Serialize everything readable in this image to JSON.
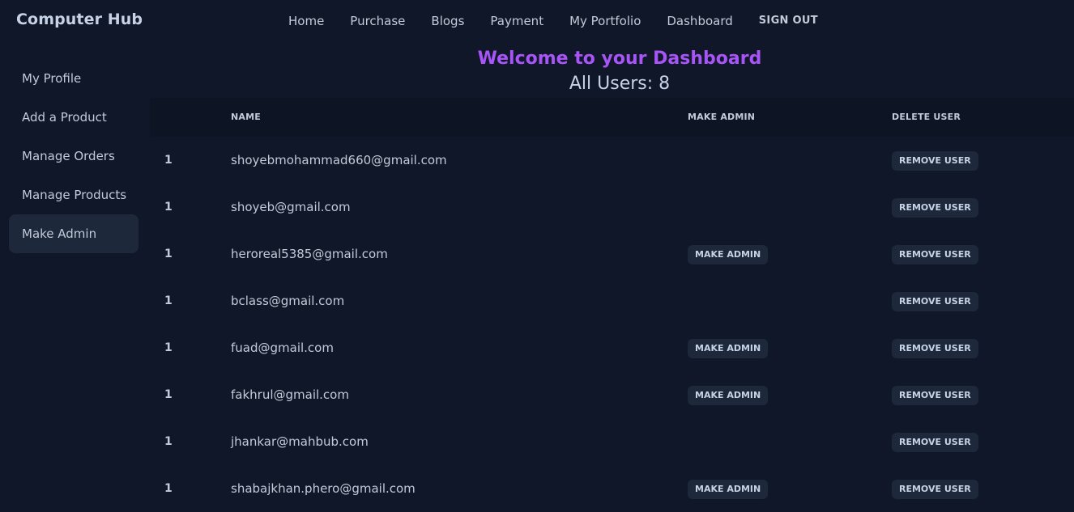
{
  "app": {
    "brand": "Computer Hub"
  },
  "nav": {
    "links": [
      "Home",
      "Purchase",
      "Blogs",
      "Payment",
      "My Portfolio",
      "Dashboard"
    ],
    "signout": "SIGN OUT"
  },
  "sidebar": {
    "items": [
      "My Profile",
      "Add a Product",
      "Manage Orders",
      "Manage Products",
      "Make Admin"
    ],
    "active": "Make Admin"
  },
  "main": {
    "welcome": "Welcome to your Dashboard",
    "user_count_label": "All Users: 8"
  },
  "table": {
    "headers": {
      "index": "",
      "name": "Name",
      "make_admin": "Make Admin",
      "delete_user": "Delete User"
    },
    "make_admin_label": "Make Admin",
    "remove_label": "Remove User",
    "rows": [
      {
        "index": "1",
        "email": "shoyebmohammad660@gmail.com",
        "can_make_admin": false
      },
      {
        "index": "1",
        "email": "shoyeb@gmail.com",
        "can_make_admin": false
      },
      {
        "index": "1",
        "email": "heroreal5385@gmail.com",
        "can_make_admin": true
      },
      {
        "index": "1",
        "email": "bclass@gmail.com",
        "can_make_admin": false
      },
      {
        "index": "1",
        "email": "fuad@gmail.com",
        "can_make_admin": true
      },
      {
        "index": "1",
        "email": "fakhrul@gmail.com",
        "can_make_admin": true
      },
      {
        "index": "1",
        "email": "jhankar@mahbub.com",
        "can_make_admin": false
      },
      {
        "index": "1",
        "email": "shabajkhan.phero@gmail.com",
        "can_make_admin": true
      }
    ]
  },
  "colors": {
    "background": "#0f1729",
    "accent": "#a855f7",
    "button_bg": "#1d283a",
    "text": "#c3cad8"
  }
}
